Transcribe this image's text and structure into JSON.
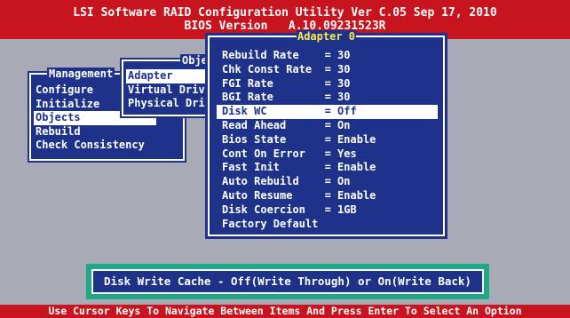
{
  "title": {
    "line1": "LSI Software RAID Configuration Utility Ver C.05 Sep 17, 2010",
    "line2": "BIOS Version   A.10.09231523R"
  },
  "management_menu": {
    "header": "Management",
    "items": [
      "Configure",
      "Initialize",
      "Objects",
      "Rebuild",
      "Check Consistency"
    ],
    "selected": "Objects"
  },
  "objects_menu": {
    "header": "Obje",
    "items": [
      "Adapter",
      "Virtual Driv",
      "Physical Dri"
    ],
    "selected": "Adapter"
  },
  "adapter_menu": {
    "header": "Adapter 0",
    "items": [
      {
        "label": "Rebuild Rate    = 30"
      },
      {
        "label": "Chk Const Rate  = 30"
      },
      {
        "label": "FGI Rate        = 30"
      },
      {
        "label": "BGI Rate        = 30"
      },
      {
        "label": "Disk WC         = Off",
        "selected": true
      },
      {
        "label": "Read Ahead      = On"
      },
      {
        "label": "Bios State      = Enable"
      },
      {
        "label": "Cont On Error   = Yes"
      },
      {
        "label": "Fast Init       = Enable"
      },
      {
        "label": "Auto Rebuild    = On"
      },
      {
        "label": "Auto Resume     = Enable"
      },
      {
        "label": "Disk Coercion   = 1GB"
      },
      {
        "label": "Factory Default"
      }
    ]
  },
  "help_text": "Disk Write Cache - Off(Write Through) or On(Write Back)",
  "status_text": "Use Cursor Keys To Navigate Between Items And Press Enter To Select An Option",
  "colors": {
    "background": "#a8aab6",
    "title_bar": "#c8141e",
    "panel": "#1e3289",
    "help_frame": "#1fa886",
    "header_accent": "#ffe94a"
  }
}
